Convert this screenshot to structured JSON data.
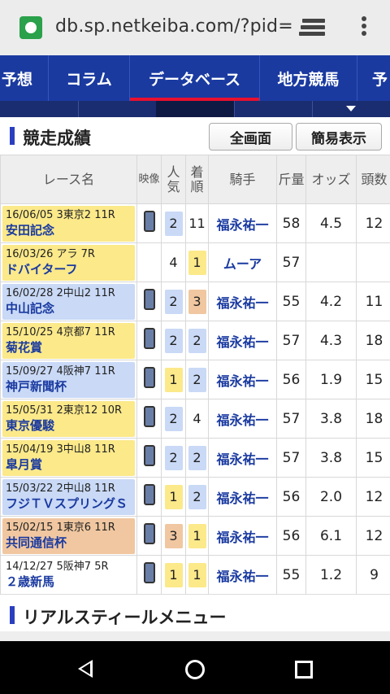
{
  "browser": {
    "url": "db.sp.netkeiba.com/?pid=",
    "favicon": "site-favicon",
    "tabs_icon": "tabs-switcher-icon",
    "menu_icon": "overflow-menu-icon"
  },
  "nav": {
    "items": [
      "予想",
      "コラム",
      "データベース",
      "地方競馬",
      "予"
    ],
    "active_index": 2
  },
  "section": {
    "title": "競走成績",
    "fullscreen_label": "全画面",
    "simple_label": "簡易表示"
  },
  "table": {
    "headers": {
      "race": "レース名",
      "video": "映像",
      "popularity": "人気",
      "finish": "着順",
      "jockey": "騎手",
      "weight": "斤量",
      "odds": "オッズ",
      "heads": "頭数"
    },
    "rows": [
      {
        "date": "16/06/05 3東京2 11R",
        "name": "安田記念",
        "color": "yellow",
        "video": true,
        "pop": "2",
        "pop_color": "blue",
        "finish": "11",
        "finish_color": "none",
        "jockey": "福永祐一",
        "weight": "58",
        "odds": "4.5",
        "heads": "12"
      },
      {
        "date": "16/03/26 アラ 7R",
        "name": "ドバイターフ",
        "color": "yellow",
        "video": false,
        "pop": "4",
        "pop_color": "none",
        "finish": "1",
        "finish_color": "yellow",
        "jockey": "ムーア",
        "weight": "57",
        "odds": "",
        "heads": ""
      },
      {
        "date": "16/02/28 2中山2 11R",
        "name": "中山記念",
        "color": "blue",
        "video": true,
        "pop": "2",
        "pop_color": "blue",
        "finish": "3",
        "finish_color": "orange",
        "jockey": "福永祐一",
        "weight": "55",
        "odds": "4.2",
        "heads": "11"
      },
      {
        "date": "15/10/25 4京都7 11R",
        "name": "菊花賞",
        "color": "yellow",
        "video": true,
        "pop": "2",
        "pop_color": "blue",
        "finish": "2",
        "finish_color": "blue",
        "jockey": "福永祐一",
        "weight": "57",
        "odds": "4.3",
        "heads": "18"
      },
      {
        "date": "15/09/27 4阪神7 11R",
        "name": "神戸新聞杯",
        "color": "blue",
        "video": true,
        "pop": "1",
        "pop_color": "yellow",
        "finish": "2",
        "finish_color": "blue",
        "jockey": "福永祐一",
        "weight": "56",
        "odds": "1.9",
        "heads": "15"
      },
      {
        "date": "15/05/31 2東京12 10R",
        "name": "東京優駿",
        "color": "yellow",
        "video": true,
        "pop": "2",
        "pop_color": "blue",
        "finish": "4",
        "finish_color": "none",
        "jockey": "福永祐一",
        "weight": "57",
        "odds": "3.8",
        "heads": "18"
      },
      {
        "date": "15/04/19 3中山8 11R",
        "name": "皐月賞",
        "color": "yellow",
        "video": true,
        "pop": "2",
        "pop_color": "blue",
        "finish": "2",
        "finish_color": "blue",
        "jockey": "福永祐一",
        "weight": "57",
        "odds": "3.8",
        "heads": "15"
      },
      {
        "date": "15/03/22 2中山8 11R",
        "name": "フジＴＶスプリングＳ",
        "color": "blue",
        "video": true,
        "pop": "1",
        "pop_color": "yellow",
        "finish": "2",
        "finish_color": "blue",
        "jockey": "福永祐一",
        "weight": "56",
        "odds": "2.0",
        "heads": "12"
      },
      {
        "date": "15/02/15 1東京6 11R",
        "name": "共同通信杯",
        "color": "orange",
        "video": true,
        "pop": "3",
        "pop_color": "orange",
        "finish": "1",
        "finish_color": "yellow",
        "jockey": "福永祐一",
        "weight": "56",
        "odds": "6.1",
        "heads": "12"
      },
      {
        "date": "14/12/27 5阪神7 5R",
        "name": "２歳新馬",
        "color": "white",
        "video": true,
        "pop": "1",
        "pop_color": "yellow",
        "finish": "1",
        "finish_color": "yellow",
        "jockey": "福永祐一",
        "weight": "55",
        "odds": "1.2",
        "heads": "9"
      }
    ]
  },
  "menu_section": {
    "title": "リアルスティールメニュー"
  },
  "system_nav": {
    "back": "back-icon",
    "home": "home-icon",
    "recents": "recents-icon"
  }
}
